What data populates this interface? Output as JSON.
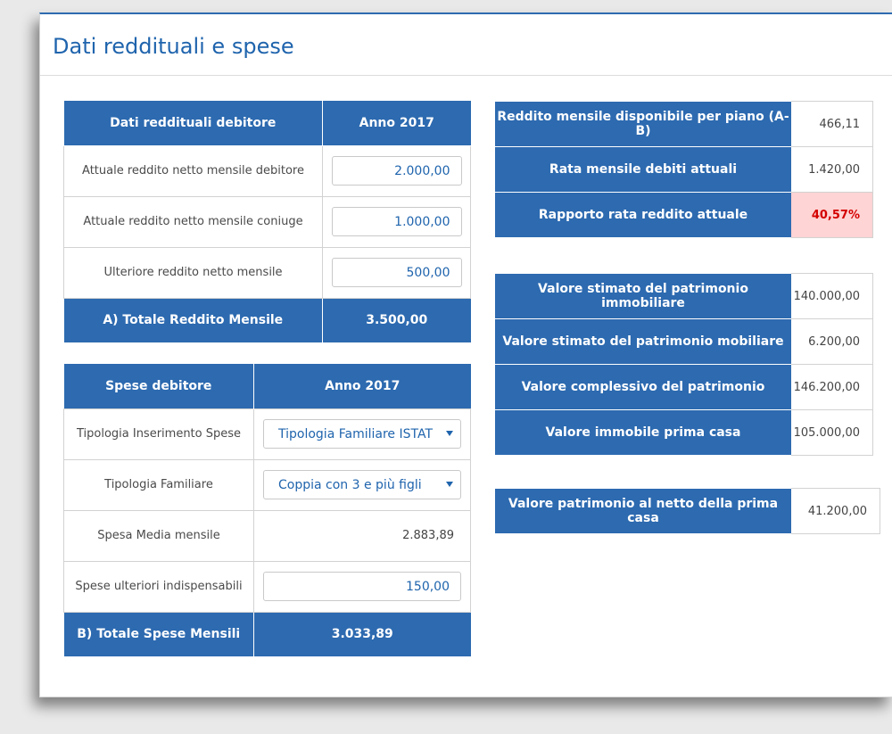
{
  "title": "Dati reddituali e spese",
  "income": {
    "header_label": "Dati reddituali debitore",
    "header_year": "Anno 2017",
    "rows": [
      {
        "label": "Attuale reddito netto mensile debitore",
        "value": "2.000,00"
      },
      {
        "label": "Attuale reddito netto mensile coniuge",
        "value": "1.000,00"
      },
      {
        "label": "Ulteriore reddito netto mensile",
        "value": "500,00"
      }
    ],
    "total_label": "A) Totale Reddito Mensile",
    "total_value": "3.500,00"
  },
  "expenses": {
    "header_label": "Spese debitore",
    "header_year": "Anno 2017",
    "tipologia_inserimento": {
      "label": "Tipologia Inserimento Spese",
      "selected": "Tipologia Familiare ISTAT"
    },
    "tipologia_familiare": {
      "label": "Tipologia Familiare",
      "selected": "Coppia con 3 e più figli"
    },
    "spesa_media": {
      "label": "Spesa Media mensile",
      "value": "2.883,89"
    },
    "spese_ulteriori": {
      "label": "Spese ulteriori indispensabili",
      "value": "150,00"
    },
    "total_label": "B) Totale Spese Mensili",
    "total_value": "3.033,89"
  },
  "summary": [
    {
      "label": "Reddito mensile disponibile per piano (A-B)",
      "value": "466,11"
    },
    {
      "label": "Rata mensile debiti attuali",
      "value": "1.420,00"
    },
    {
      "label": "Rapporto rata reddito attuale",
      "value": "40,57%"
    }
  ],
  "patrimonio": [
    {
      "label": "Valore stimato del patrimonio immobiliare",
      "value": "140.000,00"
    },
    {
      "label": "Valore stimato del patrimonio mobiliare",
      "value": "6.200,00"
    },
    {
      "label": "Valore complessivo del patrimonio",
      "value": "146.200,00"
    },
    {
      "label": "Valore immobile prima casa",
      "value": "105.000,00"
    }
  ],
  "netto": {
    "label": "Valore patrimonio al netto della prima casa",
    "value": "41.200,00"
  },
  "colors": {
    "primary": "#2d6ab0",
    "title": "#1f64ad",
    "alert_bg": "#ffd4d4",
    "alert_text": "#d40000"
  }
}
